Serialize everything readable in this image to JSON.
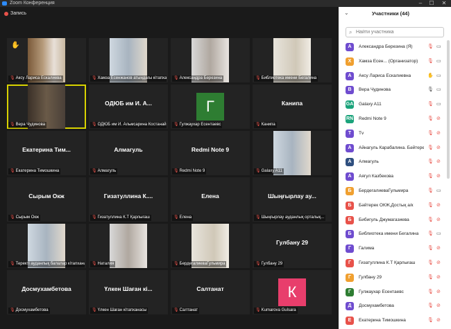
{
  "window": {
    "title": "Zoom Конференция",
    "minimize": "–",
    "maximize": "☐",
    "close": "✕"
  },
  "recording": {
    "label": "Запись"
  },
  "tiles": [
    {
      "label": "Аксу Лариса Ескалиева",
      "name": "",
      "hand": true,
      "video": true
    },
    {
      "label": "Хамза Есенжанов атындағы кітапхана",
      "name": "",
      "video": true
    },
    {
      "label": "Александра Березина",
      "name": "",
      "video": true
    },
    {
      "label": "Библиотека имени Бегалина",
      "name": "",
      "video": true
    },
    {
      "label": "Вера Чудинова",
      "name": "",
      "video": true,
      "active": true
    },
    {
      "label": "ОДЮБ им И. Альмсарина Костанай",
      "name": "ОДЮБ им И. А..."
    },
    {
      "label": "Гулжаухар Есентаевс",
      "name": "",
      "avatar": "Г",
      "avatar_color": "#2e7d32"
    },
    {
      "label": "Канипа",
      "name": "Канипа"
    },
    {
      "label": "Екатерина Тимошкина",
      "name": "Екатерина Тим..."
    },
    {
      "label": "Алмагуль",
      "name": "Алмагуль"
    },
    {
      "label": "Redmi Note 9",
      "name": "Redmi Note 9"
    },
    {
      "label": "Galaxy A11",
      "name": "",
      "video": true
    },
    {
      "label": "Сырым Окж",
      "name": "Сырым Окж"
    },
    {
      "label": "Гизатуллина К.Т Қарлығаш",
      "name": "Гизатуллина К...."
    },
    {
      "label": "Елена",
      "name": "Елена"
    },
    {
      "label": "Шыңғырлау ауданлық орталық...",
      "name": "Шыңғырлау ау..."
    },
    {
      "label": "Теректі ауданлық балалар кітапханасы",
      "name": "",
      "video": true
    },
    {
      "label": "Наталия",
      "name": "",
      "video": true
    },
    {
      "label": "БердегалиеваГульмира",
      "name": "",
      "video": true
    },
    {
      "label": "Гулбану 29",
      "name": "Гулбану 29"
    },
    {
      "label": "Досмухамбетова",
      "name": "Досмухамбетова"
    },
    {
      "label": "Үлкен Шаған кітапханасы",
      "name": "Үлкен Шаған кі..."
    },
    {
      "label": "Салтанат",
      "name": "Салтанат"
    },
    {
      "label": "Kumarova Gulsara",
      "name": "",
      "avatar": "К",
      "avatar_color": "#e83e6c"
    }
  ],
  "participants_panel": {
    "title": "Участники (44)",
    "search_placeholder": "Найти участника",
    "participants": [
      {
        "name": "Александра Березина (Я)",
        "initial": "А",
        "color": "#6f4ccf",
        "mic": "muted",
        "cam": "on"
      },
      {
        "name": "Хамза Есен...  (Организатор)",
        "initial": "Х",
        "color": "#f0a030",
        "mic": "muted",
        "cam": "on"
      },
      {
        "name": "Аксу Лариса Ескалиевна",
        "initial": "А",
        "color": "#6f4ccf",
        "mic": "hand",
        "cam": "on"
      },
      {
        "name": "Вера Чудинова",
        "initial": "В",
        "color": "#6f4ccf",
        "mic": "on",
        "cam": "on"
      },
      {
        "name": "Galaxy A11",
        "initial": "GA",
        "color": "#1ba37b",
        "mic": "muted",
        "cam": "on"
      },
      {
        "name": "Redmi Note 9",
        "initial": "RN",
        "color": "#1ba37b",
        "mic": "muted",
        "cam": "off"
      },
      {
        "name": "Tv",
        "initial": "T",
        "color": "#6f4ccf",
        "mic": "muted",
        "cam": "off"
      },
      {
        "name": "Айнагуль Карабалина. Бәйтерек",
        "initial": "А",
        "color": "#6f4ccf",
        "mic": "muted",
        "cam": "off"
      },
      {
        "name": "Алмагуль",
        "initial": "А",
        "color": "#2f4f7f",
        "mic": "muted",
        "cam": "off"
      },
      {
        "name": "Аягул Казбекова",
        "initial": "А",
        "color": "#6f4ccf",
        "mic": "muted",
        "cam": "off"
      },
      {
        "name": "БердегалиеваГульмира",
        "initial": "Б",
        "color": "#f0a030",
        "mic": "muted",
        "cam": "on"
      },
      {
        "name": "Бәйтерек ОКЖ,Достық а/к",
        "initial": "Б",
        "color": "#e8524a",
        "mic": "muted",
        "cam": "off"
      },
      {
        "name": "Бибигуль Джумагазиева",
        "initial": "Б",
        "color": "#e8524a",
        "mic": "muted",
        "cam": "off"
      },
      {
        "name": "Библиотека имени Бегалина",
        "initial": "Б",
        "color": "#6f4ccf",
        "mic": "muted",
        "cam": "on"
      },
      {
        "name": "Галима",
        "initial": "Г",
        "color": "#6f4ccf",
        "mic": "muted",
        "cam": "off"
      },
      {
        "name": "Гизатуллина К.Т Қарлығаш",
        "initial": "Г",
        "color": "#e8524a",
        "mic": "muted",
        "cam": "off"
      },
      {
        "name": "Гулбану 29",
        "initial": "Г",
        "color": "#f0a030",
        "mic": "muted",
        "cam": "off"
      },
      {
        "name": "Гулжаухар Есентаевс",
        "initial": "Г",
        "color": "#2e7d32",
        "mic": "muted",
        "cam": "off"
      },
      {
        "name": "Досмухамбетова",
        "initial": "Д",
        "color": "#6f4ccf",
        "mic": "muted",
        "cam": "off"
      },
      {
        "name": "Екатерина Тимошкина",
        "initial": "Е",
        "color": "#e8524a",
        "mic": "muted",
        "cam": "off"
      }
    ]
  }
}
